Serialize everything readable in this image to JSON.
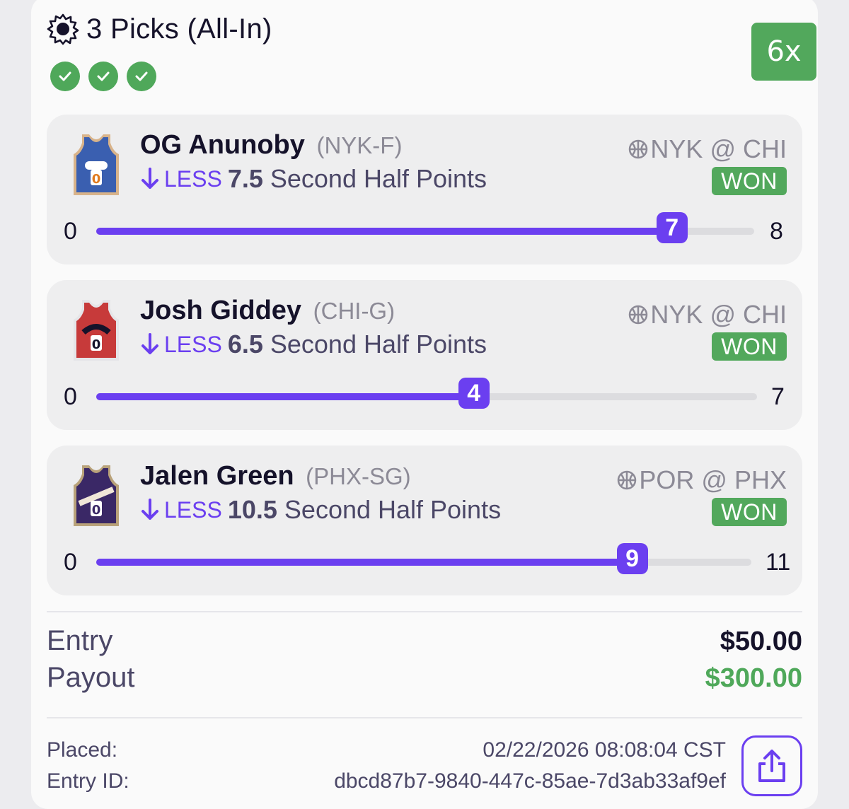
{
  "header": {
    "title": "3 Picks (All-In)",
    "icon": "gear-sun-icon",
    "checks": [
      "check-icon",
      "check-icon",
      "check-icon"
    ],
    "multiplier": "6x"
  },
  "picks": [
    {
      "player": "OG Anunoby",
      "position": "(NYK-F)",
      "direction": "LESS",
      "line": "7.5",
      "stat": "Second Half Points",
      "matchup": "NYK @ CHI",
      "result": "WON",
      "min": "0",
      "max": "8",
      "value": "7",
      "jersey_color": "#3a5fb0"
    },
    {
      "player": "Josh Giddey",
      "position": "(CHI-G)",
      "direction": "LESS",
      "line": "6.5",
      "stat": "Second Half Points",
      "matchup": "NYK @ CHI",
      "result": "WON",
      "min": "0",
      "max": "7",
      "value": "4",
      "jersey_color": "#c73a3a"
    },
    {
      "player": "Jalen Green",
      "position": "(PHX-SG)",
      "direction": "LESS",
      "line": "10.5",
      "stat": "Second Half Points",
      "matchup": "POR @ PHX",
      "result": "WON",
      "min": "0",
      "max": "11",
      "value": "9",
      "jersey_color": "#3a2866"
    }
  ],
  "summary": {
    "entry_label": "Entry",
    "entry_value": "$50.00",
    "payout_label": "Payout",
    "payout_value": "$300.00"
  },
  "meta": {
    "placed_label": "Placed:",
    "placed_value": "02/22/2026 08:08:04 CST",
    "entry_id_label": "Entry ID:",
    "entry_id_value": "dbcd87b7-9840-447c-85ae-7d3ab33af9ef"
  },
  "colors": {
    "accent": "#6b3ff0",
    "success": "#52a85c",
    "payout": "#4fa85a"
  }
}
